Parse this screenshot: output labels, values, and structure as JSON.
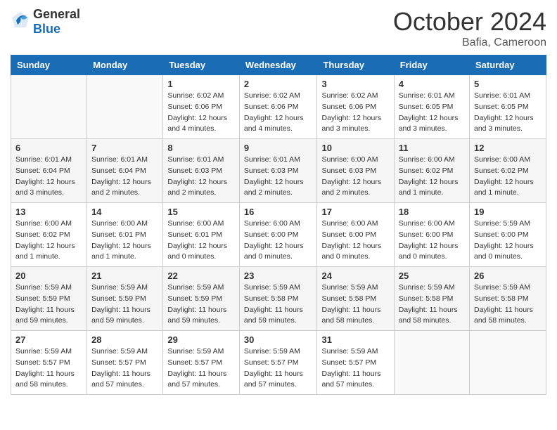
{
  "header": {
    "logo": {
      "text_general": "General",
      "text_blue": "Blue"
    },
    "title": "October 2024",
    "location": "Bafia, Cameroon"
  },
  "days_of_week": [
    "Sunday",
    "Monday",
    "Tuesday",
    "Wednesday",
    "Thursday",
    "Friday",
    "Saturday"
  ],
  "weeks": [
    [
      {
        "day": "",
        "info": ""
      },
      {
        "day": "",
        "info": ""
      },
      {
        "day": "1",
        "info": "Sunrise: 6:02 AM\nSunset: 6:06 PM\nDaylight: 12 hours\nand 4 minutes."
      },
      {
        "day": "2",
        "info": "Sunrise: 6:02 AM\nSunset: 6:06 PM\nDaylight: 12 hours\nand 4 minutes."
      },
      {
        "day": "3",
        "info": "Sunrise: 6:02 AM\nSunset: 6:06 PM\nDaylight: 12 hours\nand 3 minutes."
      },
      {
        "day": "4",
        "info": "Sunrise: 6:01 AM\nSunset: 6:05 PM\nDaylight: 12 hours\nand 3 minutes."
      },
      {
        "day": "5",
        "info": "Sunrise: 6:01 AM\nSunset: 6:05 PM\nDaylight: 12 hours\nand 3 minutes."
      }
    ],
    [
      {
        "day": "6",
        "info": "Sunrise: 6:01 AM\nSunset: 6:04 PM\nDaylight: 12 hours\nand 3 minutes."
      },
      {
        "day": "7",
        "info": "Sunrise: 6:01 AM\nSunset: 6:04 PM\nDaylight: 12 hours\nand 2 minutes."
      },
      {
        "day": "8",
        "info": "Sunrise: 6:01 AM\nSunset: 6:03 PM\nDaylight: 12 hours\nand 2 minutes."
      },
      {
        "day": "9",
        "info": "Sunrise: 6:01 AM\nSunset: 6:03 PM\nDaylight: 12 hours\nand 2 minutes."
      },
      {
        "day": "10",
        "info": "Sunrise: 6:00 AM\nSunset: 6:03 PM\nDaylight: 12 hours\nand 2 minutes."
      },
      {
        "day": "11",
        "info": "Sunrise: 6:00 AM\nSunset: 6:02 PM\nDaylight: 12 hours\nand 1 minute."
      },
      {
        "day": "12",
        "info": "Sunrise: 6:00 AM\nSunset: 6:02 PM\nDaylight: 12 hours\nand 1 minute."
      }
    ],
    [
      {
        "day": "13",
        "info": "Sunrise: 6:00 AM\nSunset: 6:02 PM\nDaylight: 12 hours\nand 1 minute."
      },
      {
        "day": "14",
        "info": "Sunrise: 6:00 AM\nSunset: 6:01 PM\nDaylight: 12 hours\nand 1 minute."
      },
      {
        "day": "15",
        "info": "Sunrise: 6:00 AM\nSunset: 6:01 PM\nDaylight: 12 hours\nand 0 minutes."
      },
      {
        "day": "16",
        "info": "Sunrise: 6:00 AM\nSunset: 6:00 PM\nDaylight: 12 hours\nand 0 minutes."
      },
      {
        "day": "17",
        "info": "Sunrise: 6:00 AM\nSunset: 6:00 PM\nDaylight: 12 hours\nand 0 minutes."
      },
      {
        "day": "18",
        "info": "Sunrise: 6:00 AM\nSunset: 6:00 PM\nDaylight: 12 hours\nand 0 minutes."
      },
      {
        "day": "19",
        "info": "Sunrise: 5:59 AM\nSunset: 6:00 PM\nDaylight: 12 hours\nand 0 minutes."
      }
    ],
    [
      {
        "day": "20",
        "info": "Sunrise: 5:59 AM\nSunset: 5:59 PM\nDaylight: 11 hours\nand 59 minutes."
      },
      {
        "day": "21",
        "info": "Sunrise: 5:59 AM\nSunset: 5:59 PM\nDaylight: 11 hours\nand 59 minutes."
      },
      {
        "day": "22",
        "info": "Sunrise: 5:59 AM\nSunset: 5:59 PM\nDaylight: 11 hours\nand 59 minutes."
      },
      {
        "day": "23",
        "info": "Sunrise: 5:59 AM\nSunset: 5:58 PM\nDaylight: 11 hours\nand 59 minutes."
      },
      {
        "day": "24",
        "info": "Sunrise: 5:59 AM\nSunset: 5:58 PM\nDaylight: 11 hours\nand 58 minutes."
      },
      {
        "day": "25",
        "info": "Sunrise: 5:59 AM\nSunset: 5:58 PM\nDaylight: 11 hours\nand 58 minutes."
      },
      {
        "day": "26",
        "info": "Sunrise: 5:59 AM\nSunset: 5:58 PM\nDaylight: 11 hours\nand 58 minutes."
      }
    ],
    [
      {
        "day": "27",
        "info": "Sunrise: 5:59 AM\nSunset: 5:57 PM\nDaylight: 11 hours\nand 58 minutes."
      },
      {
        "day": "28",
        "info": "Sunrise: 5:59 AM\nSunset: 5:57 PM\nDaylight: 11 hours\nand 57 minutes."
      },
      {
        "day": "29",
        "info": "Sunrise: 5:59 AM\nSunset: 5:57 PM\nDaylight: 11 hours\nand 57 minutes."
      },
      {
        "day": "30",
        "info": "Sunrise: 5:59 AM\nSunset: 5:57 PM\nDaylight: 11 hours\nand 57 minutes."
      },
      {
        "day": "31",
        "info": "Sunrise: 5:59 AM\nSunset: 5:57 PM\nDaylight: 11 hours\nand 57 minutes."
      },
      {
        "day": "",
        "info": ""
      },
      {
        "day": "",
        "info": ""
      }
    ]
  ]
}
